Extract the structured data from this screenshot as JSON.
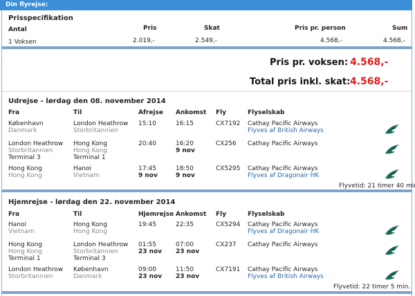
{
  "header": {
    "title": "Din flyrejse:"
  },
  "price_spec": {
    "title": "Prisspecifikation",
    "cols": {
      "antal": "Antal",
      "pris": "Pris",
      "skat": "Skat",
      "ppp": "Pris pr. person",
      "sum": "Sum"
    },
    "row": {
      "antal": "1 Voksen",
      "pris": "2.019,-",
      "skat": "2.549,-",
      "ppp": "4.568,-",
      "sum": "4.568,-"
    }
  },
  "totals": {
    "per_adult_label": "Pris pr. voksen:",
    "per_adult_value": "4.568,-",
    "total_label": "Total pris inkl. skat:",
    "total_value": "4.568,-"
  },
  "outbound": {
    "title": "Udrejse - lørdag den 08. november 2014",
    "cols": {
      "fra": "Fra",
      "til": "Til",
      "dep": "Afrejse",
      "arr": "Ankomst",
      "fly": "Fly",
      "airline": "Flyselskab"
    },
    "flights": [
      {
        "from": "København",
        "from_country": "Danmark",
        "from_terminal": "",
        "to": "London Heathrow",
        "to_country": "Storbritannien",
        "to_terminal": "",
        "dep": "15:10",
        "dep_date": "",
        "arr": "16:15",
        "arr_date": "",
        "flight": "CX7192",
        "airline": "Cathay Pacific Airways",
        "operated": "Flyves af British Airways"
      },
      {
        "from": "London Heathrow",
        "from_country": "Storbritannien",
        "from_terminal": "Terminal 3",
        "to": "Hong Kong",
        "to_country": "Hong Kong",
        "to_terminal": "Terminal 1",
        "dep": "20:40",
        "dep_date": "",
        "arr": "16:20",
        "arr_date": "9 nov",
        "flight": "CX256",
        "airline": "Cathay Pacific Airways",
        "operated": ""
      },
      {
        "from": "Hong Kong",
        "from_country": "Hong Kong",
        "from_terminal": "",
        "to": "Hanoi",
        "to_country": "Vietnam",
        "to_terminal": "",
        "dep": "17:45",
        "dep_date": "9 nov",
        "arr": "18:50",
        "arr_date": "9 nov",
        "flight": "CX5295",
        "airline": "Cathay Pacific Airways",
        "operated": "Flyves af Dragonair HK"
      }
    ],
    "flight_time": "Flyvetid: 21 timer 40 min."
  },
  "return": {
    "title": "Hjemrejse - lørdag den 22. november 2014",
    "cols": {
      "fra": "Fra",
      "til": "Til",
      "dep": "Hjemrejse",
      "arr": "Ankomst",
      "fly": "Fly",
      "airline": "Flyselskab"
    },
    "flights": [
      {
        "from": "Hanoi",
        "from_country": "Vietnam",
        "from_terminal": "",
        "to": "Hong Kong",
        "to_country": "Hong Kong",
        "to_terminal": "",
        "dep": "19:45",
        "dep_date": "",
        "arr": "22:35",
        "arr_date": "",
        "flight": "CX5294",
        "airline": "Cathay Pacific Airways",
        "operated": "Flyves af Dragonair HK"
      },
      {
        "from": "Hong Kong",
        "from_country": "Hong Kong",
        "from_terminal": "Terminal 1",
        "to": "London Heathrow",
        "to_country": "Storbritannien",
        "to_terminal": "Terminal 3",
        "dep": "01:55",
        "dep_date": "23 nov",
        "arr": "07:00",
        "arr_date": "23 nov",
        "flight": "CX237",
        "airline": "Cathay Pacific Airways",
        "operated": ""
      },
      {
        "from": "London Heathrow",
        "from_country": "Storbritannien",
        "from_terminal": "",
        "to": "København",
        "to_country": "Danmark",
        "to_terminal": "",
        "dep": "09:00",
        "dep_date": "23 nov",
        "arr": "11:50",
        "arr_date": "23 nov",
        "flight": "CX7191",
        "airline": "Cathay Pacific Airways",
        "operated": "Flyves af British Airways"
      }
    ],
    "flight_time": "Flyvetid: 22 timer 5 min."
  },
  "icons": {
    "airline_logo": "cathay-pacific-logo-icon"
  },
  "colors": {
    "header_bar": "#3c8fd6",
    "price": "#e01a1a",
    "link": "#2a63a8"
  }
}
